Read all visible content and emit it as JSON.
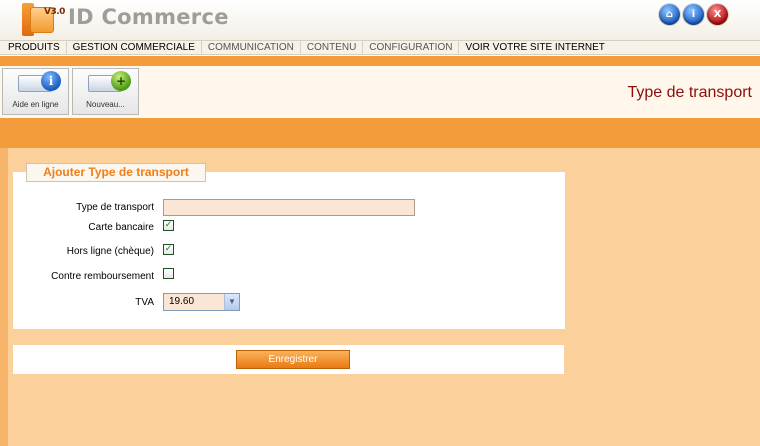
{
  "app": {
    "title": "ID Commerce",
    "logo_badge": "V3.0"
  },
  "header": {
    "icons": [
      {
        "name": "home-icon",
        "glyph": "⌂"
      },
      {
        "name": "info-icon",
        "glyph": "i"
      },
      {
        "name": "close-icon",
        "glyph": "X"
      }
    ]
  },
  "nav": {
    "items": [
      {
        "label": "PRODUITS"
      },
      {
        "label": "GESTION COMMERCIALE"
      },
      {
        "label": "COMMUNICATION"
      },
      {
        "label": "CONTENU"
      },
      {
        "label": "CONFIGURATION"
      },
      {
        "label": "VOIR VOTRE SITE INTERNET"
      }
    ]
  },
  "toolbar": {
    "help_label": "Aide en ligne",
    "new_label": "Nouveau...",
    "page_title": "Type de transport"
  },
  "form": {
    "legend": "Ajouter Type de transport",
    "transport_label": "Type de transport",
    "transport_value": "",
    "card_label": "Carte bancaire",
    "card_checked": true,
    "offline_label": "Hors ligne (chèque)",
    "offline_checked": true,
    "cod_label": "Contre remboursement",
    "cod_checked": false,
    "tva_label": "TVA",
    "tva_value": "19.60",
    "submit_label": "Enregistrer"
  },
  "colors": {
    "accent_orange": "#f29c3c",
    "content_bg": "#fcd09a",
    "title_red": "#8b0e0e",
    "legend_orange": "#ef7f1a"
  }
}
